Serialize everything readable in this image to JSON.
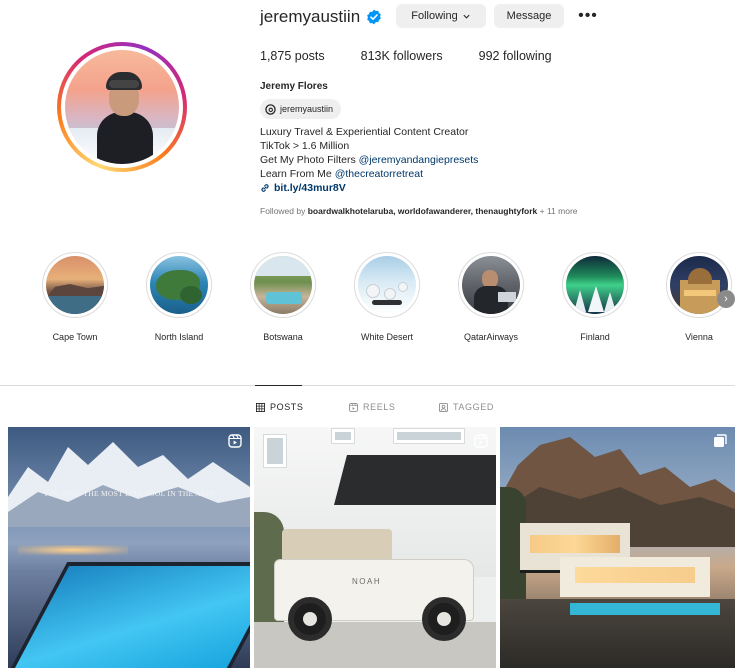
{
  "profile": {
    "username": "jeremyaustiin",
    "following_button": "Following",
    "message_button": "Message",
    "more": "•••",
    "stats": {
      "posts": "1,875 posts",
      "followers": "813K followers",
      "following": "992 following"
    },
    "full_name": "Jeremy Flores",
    "threads_handle": "jeremyaustiin",
    "bio": {
      "line1": "Luxury Travel & Experiential Content Creator",
      "line2": "TikTok > 1.6 Million",
      "line3_prefix": "Get My Photo Filters ",
      "line3_mention": "@jeremyandangiepresets",
      "line4_prefix": "Learn From Me ",
      "line4_mention": "@thecreatorretreat",
      "link": "bit.ly/43mur8V"
    },
    "followed_by": {
      "prefix": "Followed by ",
      "names": "boardwalkhotelaruba, worldofawanderer, thenaughtyfork",
      "suffix": " + 11 more"
    }
  },
  "highlights": [
    {
      "label": "Cape Town"
    },
    {
      "label": "North Island"
    },
    {
      "label": "Botswana"
    },
    {
      "label": "White Desert"
    },
    {
      "label": "QatarAirways"
    },
    {
      "label": "Finland"
    },
    {
      "label": "Vienna"
    }
  ],
  "tabs": [
    {
      "label": "POSTS",
      "icon": "grid-icon",
      "active": true
    },
    {
      "label": "REELS",
      "icon": "reels-icon",
      "active": false
    },
    {
      "label": "TAGGED",
      "icon": "tagged-icon",
      "active": false
    }
  ],
  "posts": [
    {
      "caption": "YOU FIND THE MOST EPIC POOL IN THE ALPS",
      "type_icon": "reel-icon"
    },
    {
      "brand": "NOAH",
      "type_icon": "reel-icon"
    },
    {
      "type_icon": "multi-photo-icon"
    }
  ],
  "colors": {
    "verified": "#0095f6",
    "link": "#00376b",
    "button_bg": "#efefef",
    "muted": "#737373"
  }
}
